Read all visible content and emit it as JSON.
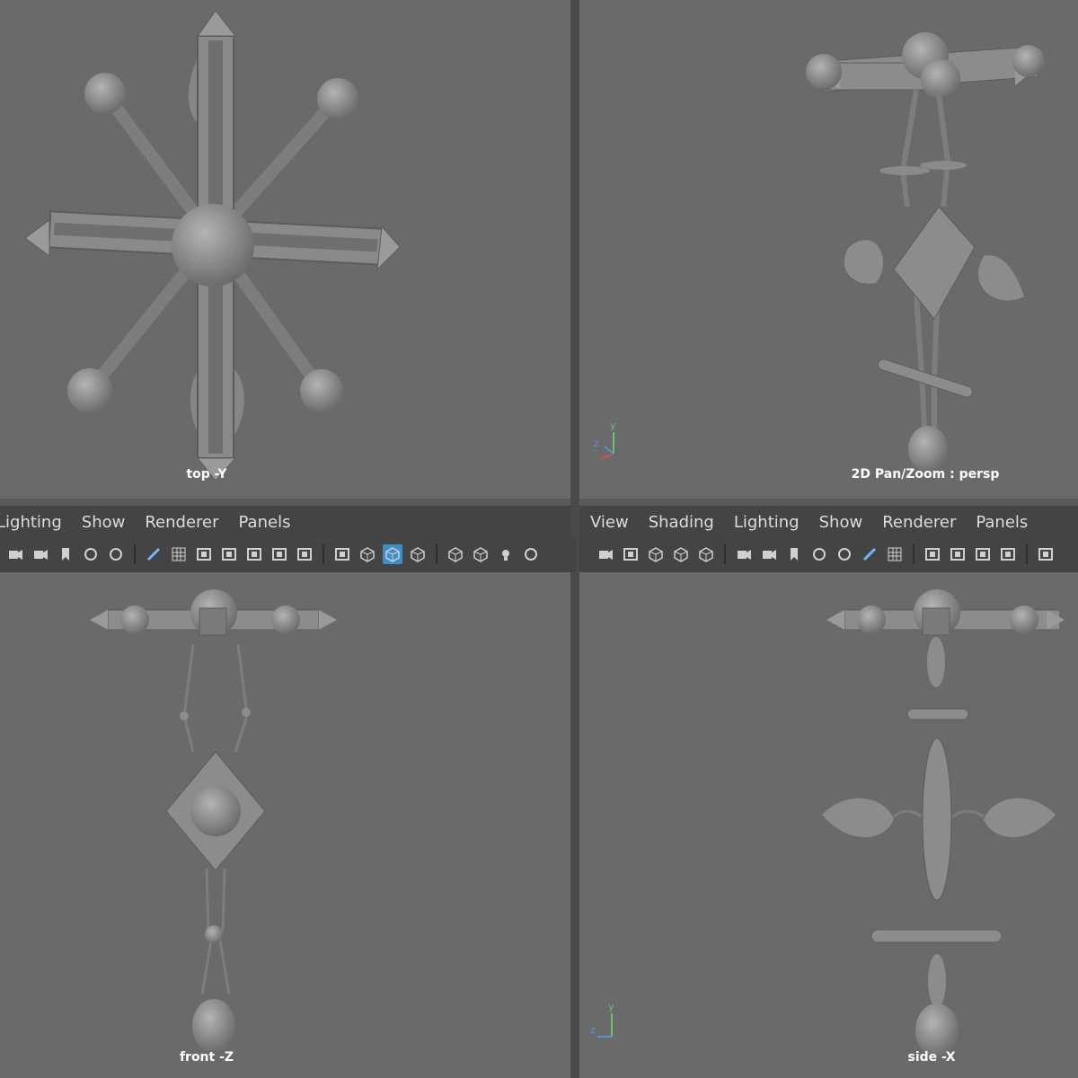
{
  "colors": {
    "viewport_bg": "#6a6a6a",
    "panel_bg": "#444444",
    "model": "#8f8f8f",
    "model_dark": "#5f5f5f",
    "accent": "#3d8fc9"
  },
  "viewports": {
    "top_left": {
      "label": "top -Y"
    },
    "top_right": {
      "label": "2D Pan/Zoom : persp"
    },
    "bottom_left": {
      "label": "front -Z"
    },
    "bottom_right": {
      "label": "side -X"
    }
  },
  "left_panel_menu": [
    "Lighting",
    "Show",
    "Renderer",
    "Panels"
  ],
  "right_panel_menu": [
    "View",
    "Shading",
    "Lighting",
    "Show",
    "Renderer",
    "Panels"
  ],
  "axis": {
    "y": "y",
    "z": "z"
  },
  "toolbar_icons_left": [
    "camera-icon",
    "camera-attributes-icon",
    "bookmark-icon",
    "image-plane-icon",
    "2d-pan-zoom-icon",
    "grease-pencil-icon",
    "grid-icon",
    "film-gate-icon",
    "resolution-gate-icon",
    "gate-mask-icon",
    "field-chart-icon",
    "safe-action-icon",
    "safe-title-icon",
    "wireframe-icon",
    "smooth-shade-icon",
    "use-default-material-icon",
    "wireframe-on-shaded-icon",
    "textured-icon",
    "lights-icon",
    "shadows-icon"
  ],
  "toolbar_icons_right": [
    "select-camera-icon",
    "film-gate-icon",
    "isolate-icon",
    "xray-icon",
    "xray-joints-icon",
    "camera-icon",
    "camera-attributes-icon",
    "bookmark-icon",
    "image-plane-icon",
    "2d-pan-zoom-icon",
    "grease-pencil-icon",
    "grid-icon",
    "film-gate-icon",
    "resolution-gate-icon",
    "gate-mask-icon",
    "field-chart-icon",
    "safe-action-icon"
  ]
}
